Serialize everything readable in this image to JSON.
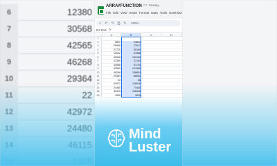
{
  "background": {
    "left_rows": [
      {
        "row": "6",
        "value": "12380"
      },
      {
        "row": "7",
        "value": "30568"
      },
      {
        "row": "8",
        "value": "42565"
      },
      {
        "row": "9",
        "value": "46268"
      },
      {
        "row": "10",
        "value": "29364"
      },
      {
        "row": "11",
        "value": "22"
      },
      {
        "row": "12",
        "value": "42972"
      },
      {
        "row": "13",
        "value": "24480"
      },
      {
        "row": "14",
        "value": "46115"
      },
      {
        "row": "15",
        "value": "1505"
      }
    ]
  },
  "app": {
    "title": "ARRAYFUNCTION",
    "status": "Saving...",
    "menus": [
      "File",
      "Edit",
      "View",
      "Insert",
      "Format",
      "Data",
      "Tools",
      "Extensions"
    ],
    "zoom": "100%",
    "cell_ref": "B1:B16",
    "fx": "fx"
  },
  "columns": [
    "A",
    "B",
    "C",
    "D"
  ],
  "rows": [
    {
      "num": "1",
      "a": "",
      "b": ""
    },
    {
      "num": "2",
      "a": "6800",
      "b": "24644"
    },
    {
      "num": "3",
      "a": "25908",
      "b": "73017"
    },
    {
      "num": "4",
      "a": "21725",
      "b": "65160"
    },
    {
      "num": "5",
      "a": "10022",
      "b": "67866"
    },
    {
      "num": "6",
      "a": "32598",
      "b": "102184"
    },
    {
      "num": "7",
      "a": "12380",
      "b": "37140"
    },
    {
      "num": "8",
      "a": "30568",
      "b": "91704"
    },
    {
      "num": "9",
      "a": "42565",
      "b": "127695"
    },
    {
      "num": "10",
      "a": "46268",
      "b": "138804"
    },
    {
      "num": "11",
      "a": "29364",
      "b": "88092"
    },
    {
      "num": "12",
      "a": "22",
      "b": "66"
    },
    {
      "num": "13",
      "a": "42972",
      "b": "128916"
    },
    {
      "num": "14",
      "a": "24480",
      "b": "73440"
    },
    {
      "num": "15",
      "a": "46115",
      "b": "138345"
    },
    {
      "num": "16",
      "a": "1505",
      "b": "4515"
    }
  ],
  "logo": {
    "line1": "Mind",
    "line2": "Luster"
  }
}
